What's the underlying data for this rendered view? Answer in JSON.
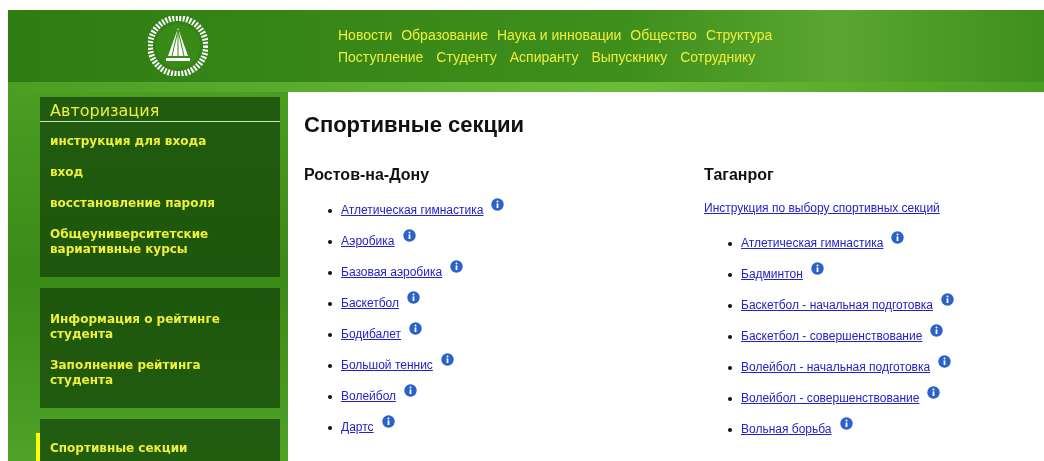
{
  "header": {
    "nav_rows": [
      [
        "Новости",
        "Образование",
        "Наука и инновации",
        "Общество",
        "Структура"
      ],
      [
        "Поступление",
        "Студенту",
        "Аспиранту",
        "Выпускнику",
        "Сотруднику"
      ]
    ]
  },
  "sidebar": {
    "panels": [
      {
        "title": "Авторизация",
        "items": [
          {
            "label": "инструкция для входа",
            "selected": false
          },
          {
            "label": "вход",
            "selected": false
          },
          {
            "label": "восстановление пароля",
            "selected": false
          },
          {
            "label": "Общеуниверситетские вариативные курсы",
            "selected": false
          }
        ]
      },
      {
        "items": [
          {
            "label": "Информация о рейтинге студента",
            "selected": false
          },
          {
            "label": "Заполнение рейтинга студента",
            "selected": false
          }
        ]
      },
      {
        "items": [
          {
            "label": "Спортивные секции",
            "selected": true
          }
        ]
      }
    ]
  },
  "content": {
    "title": "Спортивные секции",
    "columns": [
      {
        "heading": "Ростов-на-Дону",
        "sections": [
          "Атлетическая гимнастика",
          "Аэробика",
          "Базовая аэробика",
          "Баскетбол",
          "Бодибалет",
          "Большой теннис",
          "Волейбол",
          "Дартс"
        ]
      },
      {
        "heading": "Таганрог",
        "instruction_link": "Инструкция по выбору спортивных секций",
        "sections": [
          "Атлетическая гимнастика",
          "Бадминтон",
          "Баскетбол - начальная подготовка",
          "Баскетбол - совершенствование",
          "Волейбол - начальная подготовка",
          "Волейбол - совершенствование",
          "Вольная борьба"
        ]
      }
    ]
  }
}
